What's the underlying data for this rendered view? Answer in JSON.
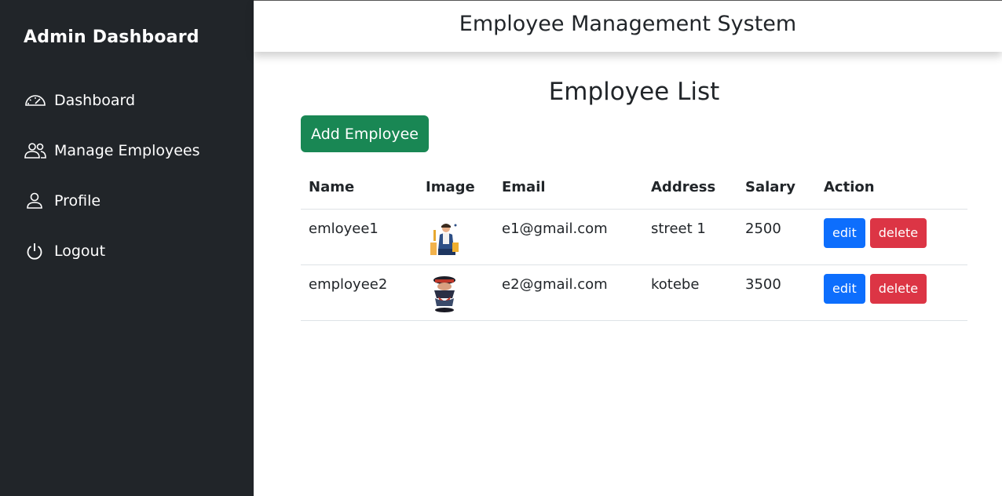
{
  "sidebar": {
    "brand": "Admin Dashboard",
    "items": [
      {
        "label": "Dashboard",
        "icon": "speedometer-icon"
      },
      {
        "label": "Manage Employees",
        "icon": "people-icon"
      },
      {
        "label": "Profile",
        "icon": "person-icon"
      },
      {
        "label": "Logout",
        "icon": "power-icon"
      }
    ]
  },
  "header": {
    "title": "Employee Management System"
  },
  "main": {
    "title": "Employee List",
    "add_button": "Add Employee",
    "columns": [
      "Name",
      "Image",
      "Email",
      "Address",
      "Salary",
      "Action"
    ],
    "rows": [
      {
        "name": "emloyee1",
        "image": "employee-photo-1",
        "email": "e1@gmail.com",
        "address": "street 1",
        "salary": "2500",
        "edit": "edit",
        "delete": "delete"
      },
      {
        "name": "employee2",
        "image": "employee-photo-2",
        "email": "e2@gmail.com",
        "address": "kotebe",
        "salary": "3500",
        "edit": "edit",
        "delete": "delete"
      }
    ]
  },
  "colors": {
    "sidebar_bg": "#212529",
    "add_button": "#198754",
    "edit_button": "#0d6efd",
    "delete_button": "#dc3545"
  }
}
